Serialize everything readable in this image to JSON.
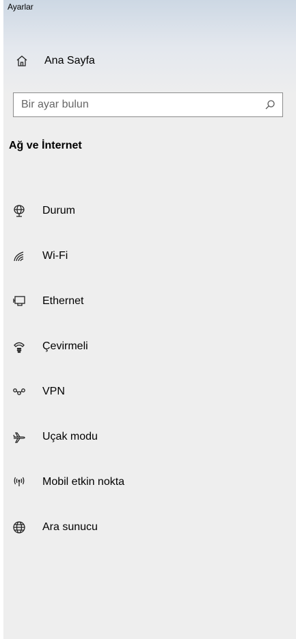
{
  "app": {
    "title": "Ayarlar"
  },
  "home": {
    "label": "Ana Sayfa",
    "icon": "home-icon"
  },
  "search": {
    "placeholder": "Bir ayar bulun",
    "value": "",
    "icon": "search-icon"
  },
  "section": {
    "title": "Ağ ve İnternet"
  },
  "nav": {
    "items": [
      {
        "label": "Durum",
        "icon": "globe-status-icon"
      },
      {
        "label": "Wi-Fi",
        "icon": "wifi-icon"
      },
      {
        "label": "Ethernet",
        "icon": "ethernet-icon"
      },
      {
        "label": "Çevirmeli",
        "icon": "dialup-icon"
      },
      {
        "label": "VPN",
        "icon": "vpn-icon"
      },
      {
        "label": "Uçak modu",
        "icon": "airplane-icon"
      },
      {
        "label": "Mobil etkin nokta",
        "icon": "hotspot-icon"
      },
      {
        "label": "Ara sunucu",
        "icon": "globe-icon"
      }
    ]
  },
  "colors": {
    "background": "#eeeeee",
    "header_gradient_top": "#cdd8e4",
    "text": "#000000",
    "search_border": "#8a8a8a"
  }
}
